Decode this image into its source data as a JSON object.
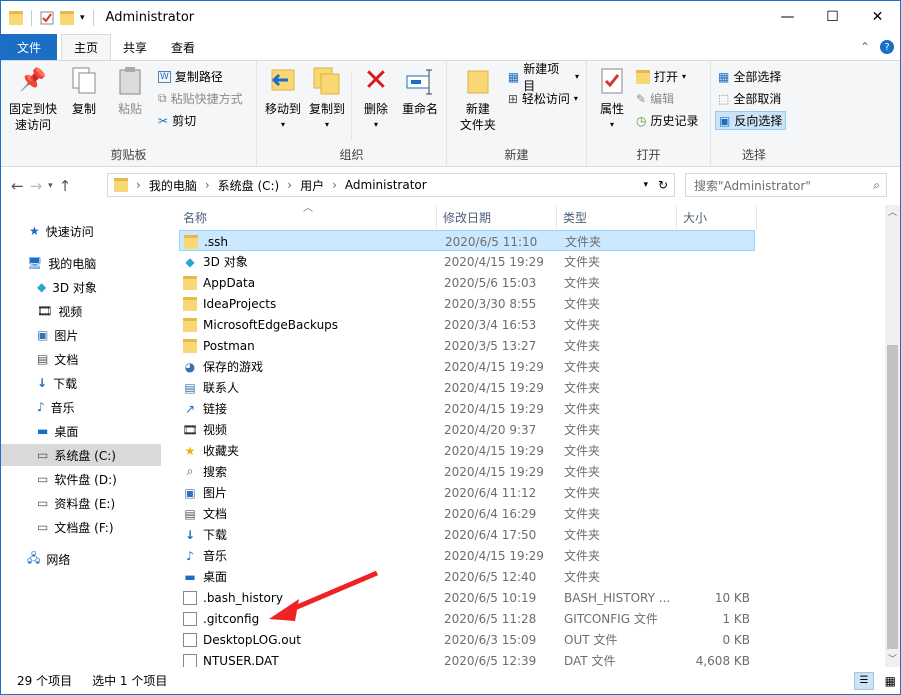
{
  "window": {
    "title": "Administrator"
  },
  "tabs": {
    "file": "文件",
    "home": "主页",
    "share": "共享",
    "view": "查看"
  },
  "ribbon": {
    "clipboard": {
      "label": "剪贴板",
      "pin": "固定到快\n速访问",
      "copy": "复制",
      "paste": "粘贴",
      "copy_path": "复制路径",
      "paste_shortcut": "粘贴快捷方式",
      "cut": "剪切"
    },
    "organize": {
      "label": "组织",
      "move_to": "移动到",
      "copy_to": "复制到",
      "delete": "删除",
      "rename": "重命名"
    },
    "new": {
      "label": "新建",
      "new_folder": "新建\n文件夹",
      "new_item": "新建项目",
      "easy_access": "轻松访问"
    },
    "open": {
      "label": "打开",
      "properties": "属性",
      "open": "打开",
      "edit": "编辑",
      "history": "历史记录"
    },
    "select": {
      "label": "选择",
      "select_all": "全部选择",
      "select_none": "全部取消",
      "invert": "反向选择"
    }
  },
  "address": {
    "crumbs": [
      "我的电脑",
      "系统盘 (C:)",
      "用户",
      "Administrator"
    ],
    "search_placeholder": "搜索\"Administrator\""
  },
  "sidebar": {
    "items": [
      {
        "label": "快速访问",
        "icon": "star-icon",
        "indent": 0
      },
      {
        "label": "我的电脑",
        "icon": "computer-icon",
        "indent": 0
      },
      {
        "label": "3D 对象",
        "icon": "cube-icon",
        "indent": 1
      },
      {
        "label": "视频",
        "icon": "video-icon",
        "indent": 1
      },
      {
        "label": "图片",
        "icon": "picture-icon",
        "indent": 1
      },
      {
        "label": "文档",
        "icon": "document-icon",
        "indent": 1
      },
      {
        "label": "下载",
        "icon": "download-icon",
        "indent": 1
      },
      {
        "label": "音乐",
        "icon": "music-icon",
        "indent": 1
      },
      {
        "label": "桌面",
        "icon": "desktop-icon",
        "indent": 1
      },
      {
        "label": "系统盘 (C:)",
        "icon": "drive-icon",
        "indent": 1,
        "selected": true
      },
      {
        "label": "软件盘 (D:)",
        "icon": "drive-icon",
        "indent": 1
      },
      {
        "label": "资料盘 (E:)",
        "icon": "drive-icon",
        "indent": 1
      },
      {
        "label": "文档盘 (F:)",
        "icon": "drive-icon",
        "indent": 1
      },
      {
        "label": "网络",
        "icon": "network-icon",
        "indent": 0
      }
    ]
  },
  "columns": {
    "name": "名称",
    "date": "修改日期",
    "type": "类型",
    "size": "大小"
  },
  "files": [
    {
      "name": ".ssh",
      "date": "2020/6/5 11:10",
      "type": "文件夹",
      "size": "",
      "icon": "folder-icon",
      "selected": true
    },
    {
      "name": "3D 对象",
      "date": "2020/4/15 19:29",
      "type": "文件夹",
      "size": "",
      "icon": "cube-icon"
    },
    {
      "name": "AppData",
      "date": "2020/5/6 15:03",
      "type": "文件夹",
      "size": "",
      "icon": "folder-icon"
    },
    {
      "name": "IdeaProjects",
      "date": "2020/3/30 8:55",
      "type": "文件夹",
      "size": "",
      "icon": "folder-icon"
    },
    {
      "name": "MicrosoftEdgeBackups",
      "date": "2020/3/4 16:53",
      "type": "文件夹",
      "size": "",
      "icon": "folder-icon"
    },
    {
      "name": "Postman",
      "date": "2020/3/5 13:27",
      "type": "文件夹",
      "size": "",
      "icon": "folder-icon"
    },
    {
      "name": "保存的游戏",
      "date": "2020/4/15 19:29",
      "type": "文件夹",
      "size": "",
      "icon": "games-icon"
    },
    {
      "name": "联系人",
      "date": "2020/4/15 19:29",
      "type": "文件夹",
      "size": "",
      "icon": "contacts-icon"
    },
    {
      "name": "链接",
      "date": "2020/4/15 19:29",
      "type": "文件夹",
      "size": "",
      "icon": "link-icon"
    },
    {
      "name": "视频",
      "date": "2020/4/20 9:37",
      "type": "文件夹",
      "size": "",
      "icon": "video-icon"
    },
    {
      "name": "收藏夹",
      "date": "2020/4/15 19:29",
      "type": "文件夹",
      "size": "",
      "icon": "star-icon"
    },
    {
      "name": "搜索",
      "date": "2020/4/15 19:29",
      "type": "文件夹",
      "size": "",
      "icon": "search-icon"
    },
    {
      "name": "图片",
      "date": "2020/6/4 11:12",
      "type": "文件夹",
      "size": "",
      "icon": "picture-icon"
    },
    {
      "name": "文档",
      "date": "2020/6/4 16:29",
      "type": "文件夹",
      "size": "",
      "icon": "document-icon"
    },
    {
      "name": "下载",
      "date": "2020/6/4 17:50",
      "type": "文件夹",
      "size": "",
      "icon": "download-icon"
    },
    {
      "name": "音乐",
      "date": "2020/4/15 19:29",
      "type": "文件夹",
      "size": "",
      "icon": "music-icon"
    },
    {
      "name": "桌面",
      "date": "2020/6/5 12:40",
      "type": "文件夹",
      "size": "",
      "icon": "desktop-icon"
    },
    {
      "name": ".bash_history",
      "date": "2020/6/5 10:19",
      "type": "BASH_HISTORY ...",
      "size": "10 KB",
      "icon": "file-icon"
    },
    {
      "name": ".gitconfig",
      "date": "2020/6/5 11:28",
      "type": "GITCONFIG 文件",
      "size": "1 KB",
      "icon": "file-icon"
    },
    {
      "name": "DesktopLOG.out",
      "date": "2020/6/3 15:09",
      "type": "OUT 文件",
      "size": "0 KB",
      "icon": "file-icon"
    },
    {
      "name": "NTUSER.DAT",
      "date": "2020/6/5 12:39",
      "type": "DAT 文件",
      "size": "4,608 KB",
      "icon": "file-icon"
    }
  ],
  "status": {
    "count": "29 个项目",
    "selected": "选中 1 个项目"
  }
}
